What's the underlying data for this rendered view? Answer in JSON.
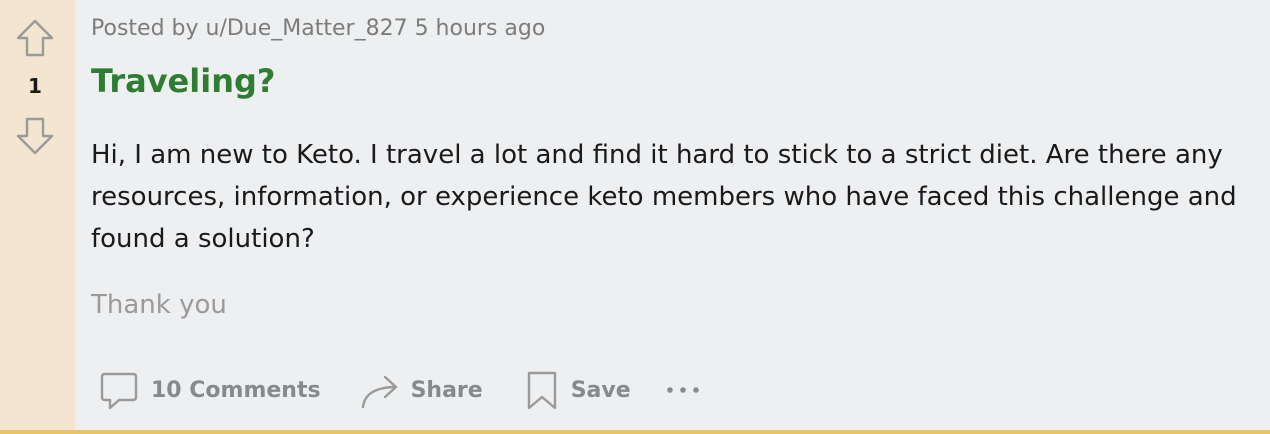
{
  "post": {
    "score": "1",
    "posted_by": "Posted by u/Due_Matter_827",
    "time_ago": "5 hours ago",
    "title": "Traveling?",
    "body": "Hi, I am new to Keto. I travel a lot and find it hard to stick to a strict diet. Are there any resources, information, or experience keto members who have faced this challenge and found a solution?",
    "footer_text": "Thank you"
  },
  "actions": {
    "comments_label": "10 Comments",
    "share_label": "Share",
    "save_label": "Save",
    "more_label": "•••"
  },
  "icons": {
    "upvote": "upvote-arrow-icon",
    "downvote": "downvote-arrow-icon",
    "comment": "comment-bubble-icon",
    "share": "share-arrow-icon",
    "save": "bookmark-icon",
    "more": "more-options-icon"
  },
  "colors": {
    "vote_column_bg": "#f3e5cf",
    "title_color": "#2e7d32",
    "action_color": "#878a8c",
    "bottom_border": "#e6c56a"
  }
}
